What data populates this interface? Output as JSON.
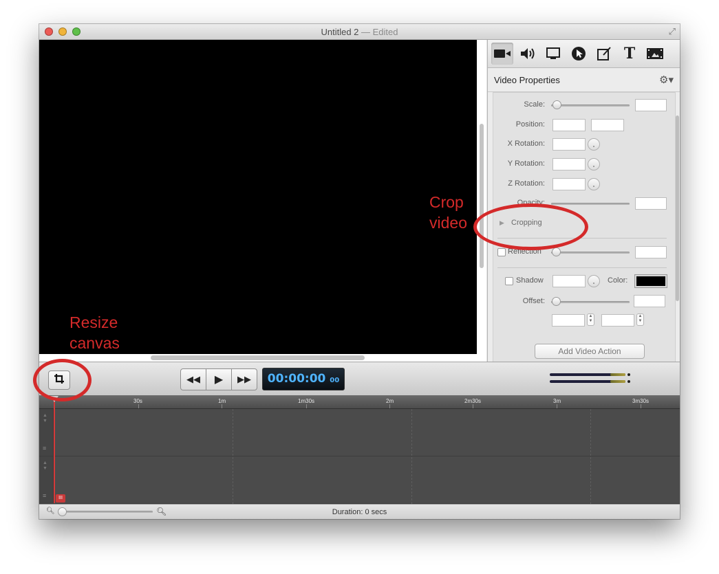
{
  "window": {
    "title": "Untitled 2",
    "title_separator": "—",
    "title_status": "Edited"
  },
  "inspector": {
    "tabs": [
      {
        "name": "video-camera-icon",
        "selected": true
      },
      {
        "name": "audio-speaker-icon",
        "selected": false
      },
      {
        "name": "screen-monitor-icon",
        "selected": false
      },
      {
        "name": "cursor-pointer-icon",
        "selected": false
      },
      {
        "name": "annotation-pencil-icon",
        "selected": false
      },
      {
        "name": "text-icon",
        "label": "T",
        "selected": false
      },
      {
        "name": "media-film-icon",
        "selected": false
      }
    ],
    "title": "Video Properties",
    "gear_label": "⚙▾",
    "scale_label": "Scale:",
    "position_label": "Position:",
    "x_rotation_label": "X Rotation:",
    "y_rotation_label": "Y Rotation:",
    "z_rotation_label": "Z Rotation:",
    "opacity_label": "Opacity:",
    "cropping_label": "Cropping",
    "reflection_label": "Reflection",
    "shadow_label": "Shadow",
    "color_label": "Color:",
    "shadow_color": "#000000",
    "offset_label": "Offset:",
    "add_action_label": "Add Video Action"
  },
  "transport": {
    "rewind": "◀◀",
    "play": "▶",
    "forward": "▶▶",
    "timecode": "00:00:00",
    "timecode_frames": "00"
  },
  "timeline": {
    "ruler_ticks": [
      "30s",
      "1m",
      "1m30s",
      "2m",
      "2m30s",
      "3m",
      "3m30s"
    ],
    "playhead_marker": "III",
    "duration": "Duration: 0 secs"
  },
  "annotations": {
    "crop_video": [
      "Crop",
      "video"
    ],
    "resize_canvas": [
      "Resize",
      "canvas"
    ],
    "color": "#d42a2a"
  }
}
